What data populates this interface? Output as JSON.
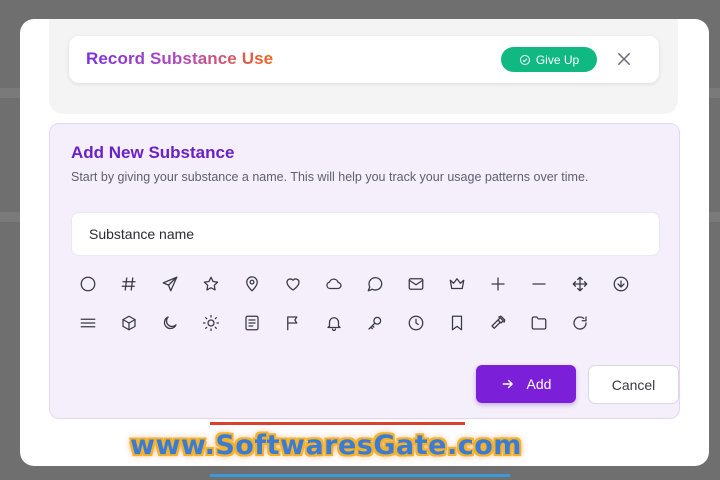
{
  "header": {
    "title": "Record Substance Use",
    "give_up_label": "Give Up",
    "close_icon": "close-icon",
    "give_up_icon": "check-circle-icon"
  },
  "form": {
    "title": "Add New Substance",
    "description": "Start by giving your substance a name. This will help you track your usage patterns over time.",
    "name_input": {
      "placeholder": "Substance name",
      "value": ""
    },
    "icons": [
      "circle-icon",
      "hash-icon",
      "send-icon",
      "star-icon",
      "map-pin-icon",
      "heart-icon",
      "cloud-icon",
      "message-circle-icon",
      "mail-icon",
      "crown-icon",
      "plus-icon",
      "minus-icon",
      "move-icon",
      "arrow-down-circle-icon",
      "menu-icon",
      "box-icon",
      "moon-icon",
      "sun-icon",
      "file-text-icon",
      "flag-icon",
      "bell-icon",
      "key-icon",
      "clock-icon",
      "bookmark-icon",
      "hammer-icon",
      "folder-icon",
      "rotate-cw-icon"
    ],
    "add_label": "Add",
    "cancel_label": "Cancel"
  },
  "watermark": {
    "text": "www.SoftwaresGate.com"
  },
  "colors": {
    "accent": "#7c1fd8",
    "give_up": "#10b981",
    "title_gradient": [
      "#7a2fe0",
      "#f0641e"
    ]
  }
}
